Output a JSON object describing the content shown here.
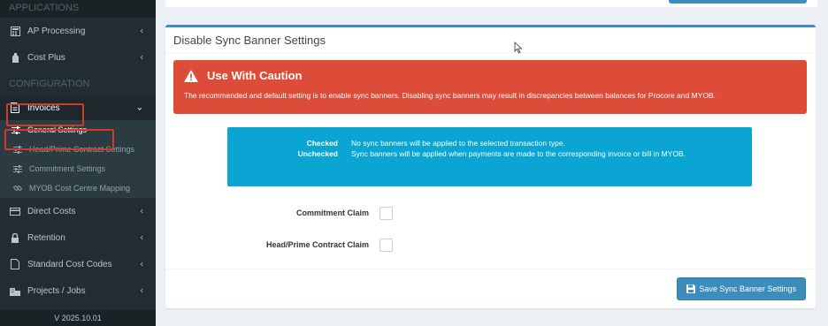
{
  "sidebar": {
    "headers": {
      "applications": "APPLICATIONS",
      "configuration": "CONFIGURATION"
    },
    "items": {
      "ap_processing": "AP Processing",
      "cost_plus": "Cost Plus",
      "invoices": "Invoices",
      "direct_costs": "Direct Costs",
      "retention": "Retention",
      "standard_cost_codes": "Standard Cost Codes",
      "projects_jobs": "Projects / Jobs"
    },
    "subitems": {
      "general_settings": "General Settings",
      "head_prime": "Head/Prime Contract Settings",
      "commitment": "Commitment Settings",
      "myob_mapping": "MYOB Cost Centre Mapping"
    },
    "version": "V 2025.10.01"
  },
  "box": {
    "title": "Disable Sync Banner Settings",
    "alert": {
      "title": "Use With Caution",
      "text": "The recommended and default setting is to enable sync banners. Disabling sync banners may result in discrepancies between balances for Procore and MYOB."
    },
    "info": {
      "checked_key": "Checked",
      "checked_val": "No sync banners will be applied to the selected transaction type.",
      "unchecked_key": "Unchecked",
      "unchecked_val": "Sync banners will be applied when payments are made to the corresponding invoice or bill in MYOB."
    },
    "fields": {
      "commitment_claim": "Commitment Claim",
      "head_prime_claim": "Head/Prime Contract Claim"
    },
    "save_label": "Save Sync Banner Settings"
  },
  "colors": {
    "sidebar": "#222d32",
    "primary": "#3c8dbc",
    "danger": "#dd4b39",
    "info": "#0aa5d2",
    "highlight": "#d33a2a"
  }
}
